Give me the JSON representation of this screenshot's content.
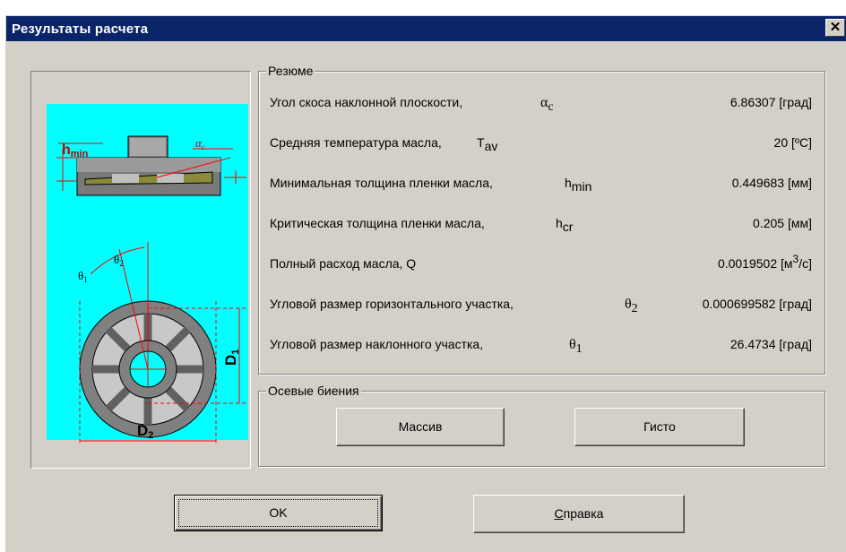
{
  "window": {
    "title": "Результаты расчета",
    "close_glyph": "✕"
  },
  "diagram": {
    "bg_color": "#00ffff",
    "labels": {
      "hmin": "h",
      "hmin_sub": "min",
      "alpha": "α",
      "alpha_sub": "c",
      "theta1": "θ",
      "theta1_sub": "1",
      "theta2": "θ",
      "theta2_sub": "2",
      "d1": "D",
      "d1_sub": "1",
      "d2": "D",
      "d2_sub": "2"
    }
  },
  "summary": {
    "title": "Резюме",
    "rows": [
      {
        "label": "Угол скоса наклонной плоскости,",
        "sym": "α",
        "sub": "c",
        "value": "6.86307 [град]"
      },
      {
        "label": "Средняя температура масла,",
        "sym": "T",
        "sub": "av",
        "value": "20 [ºC]"
      },
      {
        "label": "Минимальная толщина пленки масла,",
        "sym": "h",
        "sub": "min",
        "value": "0.449683 [мм]"
      },
      {
        "label": "Критическая толщина пленки масла,",
        "sym": "h",
        "sub": "cr",
        "value": "0.205 [мм]"
      },
      {
        "label": "Полный расход масла, Q",
        "sym": "",
        "sub": "",
        "value_num": "0.0019502",
        "value_unit_a": "[м",
        "value_unit_sup": "3",
        "value_unit_b": "/с]"
      },
      {
        "label": "Угловой размер горизонтального участка,",
        "sym": "θ",
        "sub": "2",
        "value": "0.000699582 [град]"
      },
      {
        "label": "Угловой размер наклонного участка,",
        "sym": "θ",
        "sub": "1",
        "value": "26.4734 [град]"
      }
    ]
  },
  "axial": {
    "title": "Осевые биения",
    "array_button": "Массив",
    "histo_button": "Гисто"
  },
  "footer": {
    "ok_button": "OK",
    "help_button_mnemonic": "С",
    "help_button_rest": "правка"
  }
}
